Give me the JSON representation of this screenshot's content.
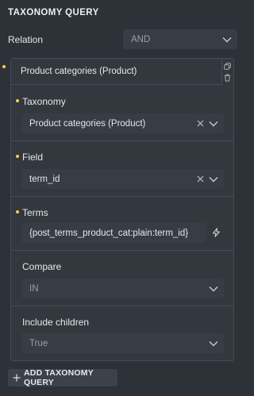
{
  "panel": {
    "title": "TAXONOMY QUERY"
  },
  "relation": {
    "label": "Relation",
    "value": "AND"
  },
  "query_item": {
    "header": "Product categories (Product)",
    "fields": {
      "taxonomy": {
        "label": "Taxonomy",
        "value": "Product categories (Product)"
      },
      "field": {
        "label": "Field",
        "value": "term_id"
      },
      "terms": {
        "label": "Terms",
        "value": "{post_terms_product_cat:plain:term_id}"
      },
      "compare": {
        "label": "Compare",
        "value": "IN"
      },
      "include_children": {
        "label": "Include children",
        "value": "True"
      }
    }
  },
  "add_button": {
    "label": "ADD TAXONOMY QUERY"
  },
  "colors": {
    "accent_dot": "#f0d34c",
    "panel_bg": "#2d3138",
    "input_bg": "#383d45"
  }
}
